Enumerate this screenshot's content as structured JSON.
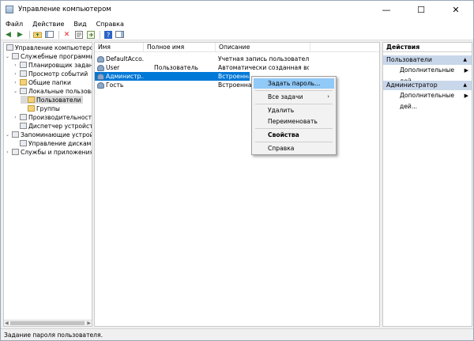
{
  "window": {
    "title": "Управление компьютером",
    "minimize": "—",
    "maximize": "☐",
    "close": "✕"
  },
  "menu": [
    "Файл",
    "Действие",
    "Вид",
    "Справка"
  ],
  "tree": {
    "root": "Управление компьютером (л",
    "items": [
      {
        "label": "Служебные программы",
        "expander": "⌄",
        "icon": "tools-icon"
      },
      {
        "label": "Планировщик заданий",
        "expander": "›",
        "icon": "clock-icon"
      },
      {
        "label": "Просмотр событий",
        "expander": "›",
        "icon": "event-viewer-icon"
      },
      {
        "label": "Общие папки",
        "expander": "›",
        "icon": "shared-folder-icon"
      },
      {
        "label": "Локальные пользовате",
        "expander": "⌄",
        "icon": "users-icon"
      },
      {
        "label": "Пользователи",
        "expander": "",
        "icon": "folder-icon"
      },
      {
        "label": "Группы",
        "expander": "",
        "icon": "folder-icon"
      },
      {
        "label": "Производительность",
        "expander": "›",
        "icon": "performance-icon"
      },
      {
        "label": "Диспетчер устройств",
        "expander": "",
        "icon": "device-manager-icon"
      },
      {
        "label": "Запоминающие устройст",
        "expander": "⌄",
        "icon": "storage-icon"
      },
      {
        "label": "Управление дисками",
        "expander": "",
        "icon": "disk-icon"
      },
      {
        "label": "Службы и приложения",
        "expander": "›",
        "icon": "services-icon"
      }
    ]
  },
  "list": {
    "columns": [
      "Имя",
      "Полное имя",
      "Описание"
    ],
    "rows": [
      {
        "name": "DefaultAcco...",
        "full_name": "",
        "description": "Учетная запись пользователя, у..."
      },
      {
        "name": "User",
        "full_name": "Пользователь",
        "description": "Автоматически созданная во вр..."
      },
      {
        "name": "Администр...",
        "full_name": "",
        "description": "Встроенная"
      },
      {
        "name": "Гость",
        "full_name": "",
        "description": "Встроенная"
      }
    ]
  },
  "context_menu": {
    "items": [
      {
        "label": "Задать пароль...",
        "highlighted": true
      },
      {
        "label": "Все задачи",
        "submenu": true
      },
      {
        "label": "Удалить"
      },
      {
        "label": "Переименовать"
      },
      {
        "label": "Свойства",
        "bold": true
      },
      {
        "label": "Справка"
      }
    ]
  },
  "actions": {
    "title": "Действия",
    "sections": [
      {
        "header": "Пользователи",
        "item": "Дополнительные дей..."
      },
      {
        "header": "Администратор",
        "item": "Дополнительные дей..."
      }
    ]
  },
  "status": "Задание пароля пользователя.",
  "colors": {
    "selection": "#0078d7",
    "menu_highlight": "#91c9f7",
    "action_header": "#c9d7ea"
  }
}
